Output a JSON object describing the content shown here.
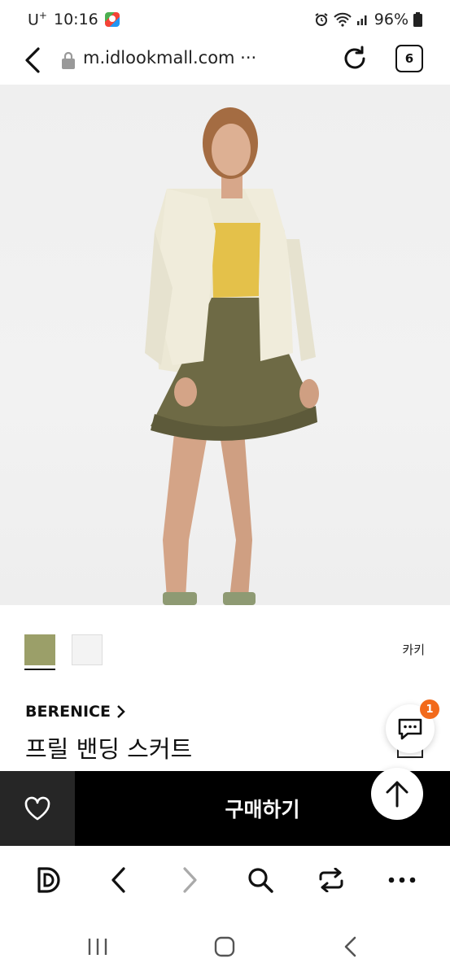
{
  "status": {
    "carrier": "U",
    "carrier_sup": "+",
    "time": "10:16",
    "battery": "96%",
    "icons": [
      "maps-icon",
      "alarm-icon",
      "wifi-icon",
      "signal-icon",
      "battery-icon"
    ]
  },
  "browser": {
    "url": "m.idlookmall.com ···",
    "tab_count": "6"
  },
  "product": {
    "image_alt": "model wearing khaki frill skirt",
    "colors": [
      {
        "name": "khaki",
        "hex": "#9b9f69",
        "selected": true
      },
      {
        "name": "white",
        "hex": "#f3f3f3",
        "selected": false
      }
    ],
    "selected_color_label": "카키",
    "brand": "BERENICE",
    "title": "프릴 밴딩 스커트"
  },
  "chat": {
    "badge_count": "1"
  },
  "actions": {
    "buy_label": "구매하기"
  },
  "accent": {
    "buy_bg": "#000000",
    "wish_bg": "#262626",
    "badge": "#f26a1b"
  }
}
